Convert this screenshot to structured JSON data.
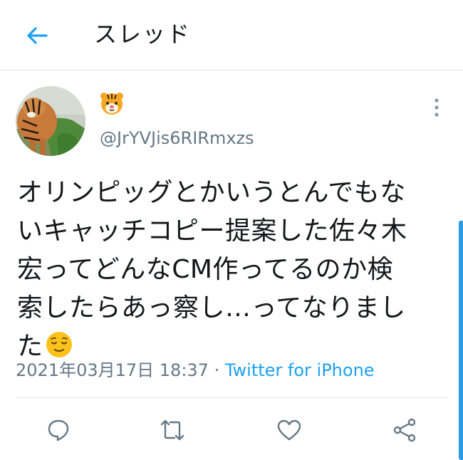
{
  "header": {
    "title": "スレッド",
    "back_icon": "back-arrow-icon"
  },
  "tweet": {
    "display_name_emoji": "🐯",
    "handle": "@JrYVJis6RIRmxzs",
    "text_lines": [
      "オリンピッグとかいうとんでもな",
      "いキャッチコピー提案した佐々木",
      "宏ってどんなCM作ってるのか検",
      "索したらあっ察し…ってなりまし",
      "た"
    ],
    "trailing_emoji": "relieved-face",
    "timestamp": "2021年03月17日 18:37",
    "separator": " · ",
    "source": "Twitter for iPhone"
  },
  "actions": [
    {
      "name": "reply",
      "icon": "reply-icon"
    },
    {
      "name": "retweet",
      "icon": "retweet-icon"
    },
    {
      "name": "like",
      "icon": "heart-icon"
    },
    {
      "name": "share",
      "icon": "share-icon"
    }
  ],
  "colors": {
    "accent": "#1da1f2",
    "muted": "#657786",
    "divider": "#e1e6ea",
    "scrollbar": "#2f9be3"
  }
}
